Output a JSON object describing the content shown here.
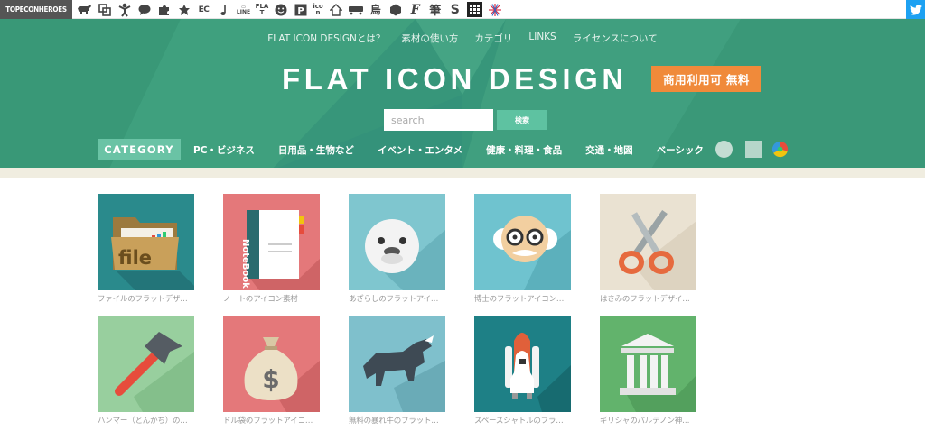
{
  "network_bar": {
    "brand": "TOPECONHEROES",
    "sites": [
      {
        "icon": "bull-icon"
      },
      {
        "icon": "squares-icon"
      },
      {
        "icon": "person-icon"
      },
      {
        "icon": "speech-bubble-icon"
      },
      {
        "icon": "puzzle-icon"
      },
      {
        "icon": "flower-icon"
      },
      {
        "text": "EC"
      },
      {
        "icon": "music-note-icon"
      },
      {
        "text": "LINE"
      },
      {
        "text": "FLAT"
      },
      {
        "icon": "smiley-icon"
      },
      {
        "icon": "p-icon"
      },
      {
        "text": "icon"
      },
      {
        "icon": "house-icon"
      },
      {
        "icon": "train-icon"
      },
      {
        "text": "烏"
      },
      {
        "icon": "hexagon-icon"
      },
      {
        "text": "F"
      },
      {
        "text": "筆"
      },
      {
        "text": "S"
      },
      {
        "icon": "grid-icon"
      },
      {
        "icon": "burst-icon"
      }
    ],
    "twitter_icon": "twitter-icon"
  },
  "header": {
    "top_links": [
      "FLAT ICON DESIGNとは？",
      "素材の使い方",
      "カテゴリ",
      "LINKS",
      "ライセンスについて"
    ],
    "logo": "FLAT ICON DESIGN",
    "badge": "商用利用可 無料",
    "search_placeholder": "search",
    "search_button": "検索",
    "category_label": "CATEGORY",
    "categories": [
      "PC・ビジネス",
      "日用品・生物など",
      "イベント・エンタメ",
      "健康・料理・食品",
      "交通・地図",
      "ベーシック"
    ],
    "shape_filters": [
      "circle-filter",
      "square-filter",
      "color-filter"
    ],
    "colors": {
      "primary": "#3a9a78",
      "accent": "#f08a3a",
      "button": "#5ec2a1"
    }
  },
  "icons": [
    {
      "caption": "ファイルのフラットデザ…",
      "icon": "file-folder-icon",
      "bg": "#2a8a8c"
    },
    {
      "caption": "ノートのアイコン素材",
      "icon": "notebook-icon",
      "bg": "#e4787a"
    },
    {
      "caption": "あざらしのフラットアイ…",
      "icon": "seal-icon",
      "bg": "#7fc6cf"
    },
    {
      "caption": "博士のフラットアイコン…",
      "icon": "professor-icon",
      "bg": "#6fc3cf"
    },
    {
      "caption": "はさみのフラットデザイ…",
      "icon": "scissors-icon",
      "bg": "#eae2d2"
    },
    {
      "caption": "ハンマー（とんかち）の…",
      "icon": "hammer-icon",
      "bg": "#98cf9e"
    },
    {
      "caption": "ドル袋のフラットアイコ…",
      "icon": "money-bag-icon",
      "bg": "#e4787a"
    },
    {
      "caption": "無料の暴れ牛のフラット…",
      "icon": "bull-icon",
      "bg": "#7fc0cc"
    },
    {
      "caption": "スペースシャトルのフラ…",
      "icon": "space-shuttle-icon",
      "bg": "#1e8086"
    },
    {
      "caption": "ギリシャのパルテノン神…",
      "icon": "parthenon-icon",
      "bg": "#62b36c"
    }
  ]
}
